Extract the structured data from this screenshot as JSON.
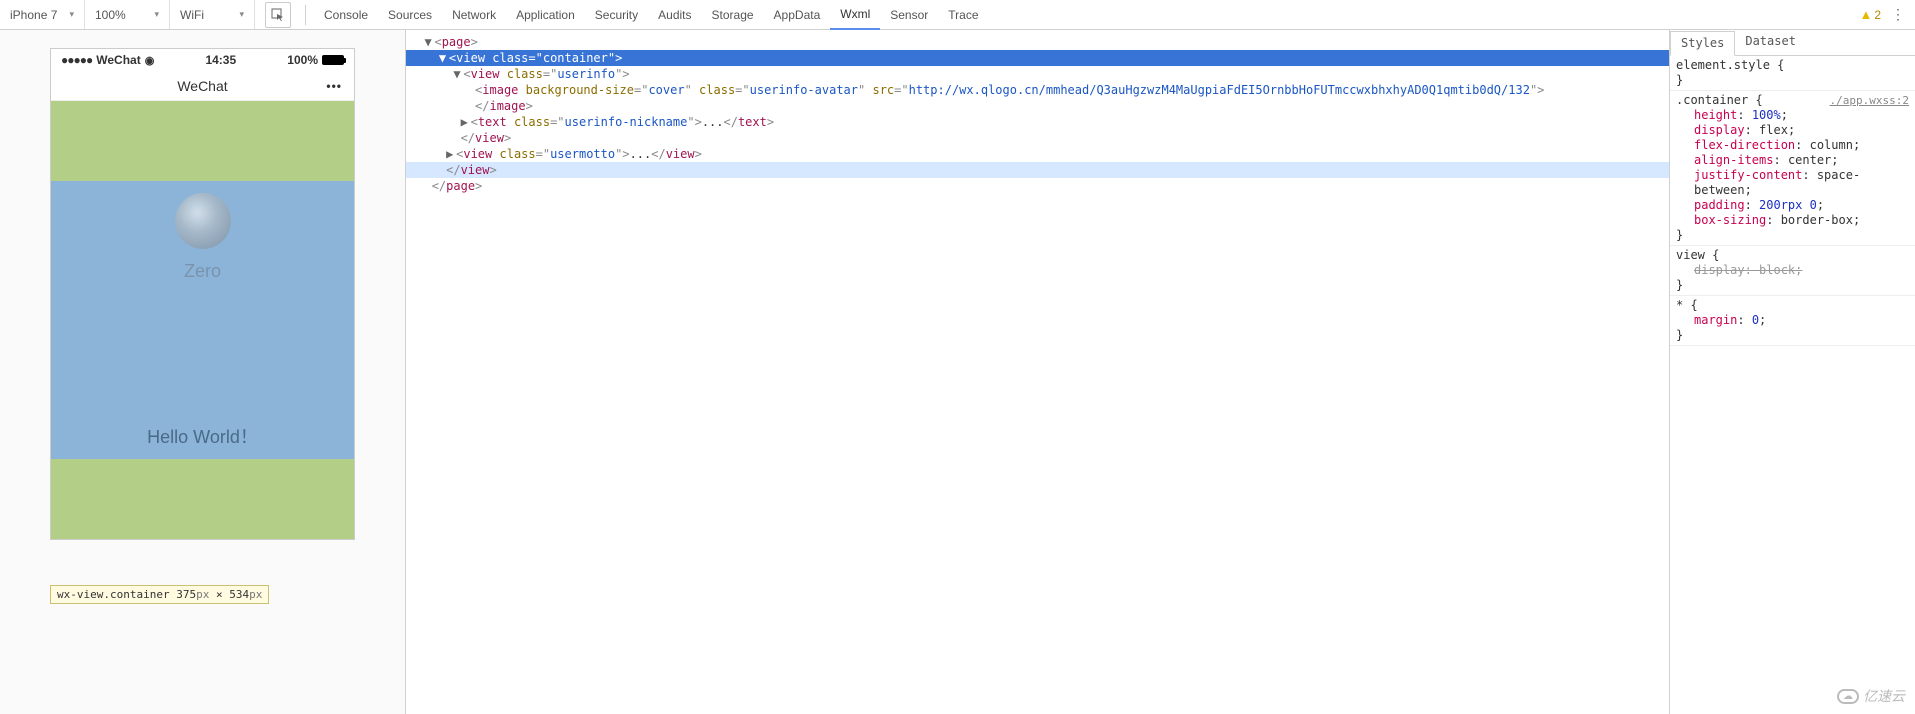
{
  "toolbar": {
    "device": "iPhone 7",
    "zoom": "100%",
    "network": "WiFi",
    "tabs": [
      "Console",
      "Sources",
      "Network",
      "Application",
      "Security",
      "Audits",
      "Storage",
      "AppData",
      "Wxml",
      "Sensor",
      "Trace"
    ],
    "active_tab": "Wxml",
    "warnings": "2"
  },
  "simulator": {
    "carrier": "WeChat",
    "time": "14:35",
    "battery_pct": "100%",
    "nav_title": "WeChat",
    "nickname": "Zero",
    "motto": "Hello World！",
    "tooltip_selector": "wx-view.container",
    "tooltip_w": "375",
    "tooltip_h": "534",
    "tooltip_px": "px"
  },
  "dom": {
    "page_open": "page",
    "view": "view",
    "image": "image",
    "text": "text",
    "class_attr": "class",
    "bgsize_attr": "background-size",
    "src_attr": "src",
    "container": "container",
    "userinfo": "userinfo",
    "cover": "cover",
    "avatar_cls": "userinfo-avatar",
    "src_val": "http://wx.qlogo.cn/mmhead/Q3auHgzwzM4MaUgpiaFdEI5OrnbbHoFUTmccwxbhxhyAD0Q1qmtib0dQ/132",
    "nick_cls": "userinfo-nickname",
    "motto_cls": "usermotto",
    "ellipsis": "..."
  },
  "styles": {
    "tabs": [
      "Styles",
      "Dataset"
    ],
    "active": "Styles",
    "element_style": "element.style {",
    "close": "}",
    "container_sel": ".container {",
    "link": "./app.wxss:2",
    "rules": [
      {
        "p": "height",
        "v": "100%"
      },
      {
        "p": "display",
        "v": "flex"
      },
      {
        "p": "flex-direction",
        "v": "column"
      },
      {
        "p": "align-items",
        "v": "center"
      },
      {
        "p": "justify-content",
        "v": "space-between"
      },
      {
        "p": "padding",
        "v": "200rpx 0"
      },
      {
        "p": "box-sizing",
        "v": "border-box"
      }
    ],
    "view_sel": "view {",
    "view_rule_p": "display",
    "view_rule_v": "block",
    "star_sel": "* {",
    "star_rule_p": "margin",
    "star_rule_v": "0"
  },
  "watermark": "亿速云"
}
